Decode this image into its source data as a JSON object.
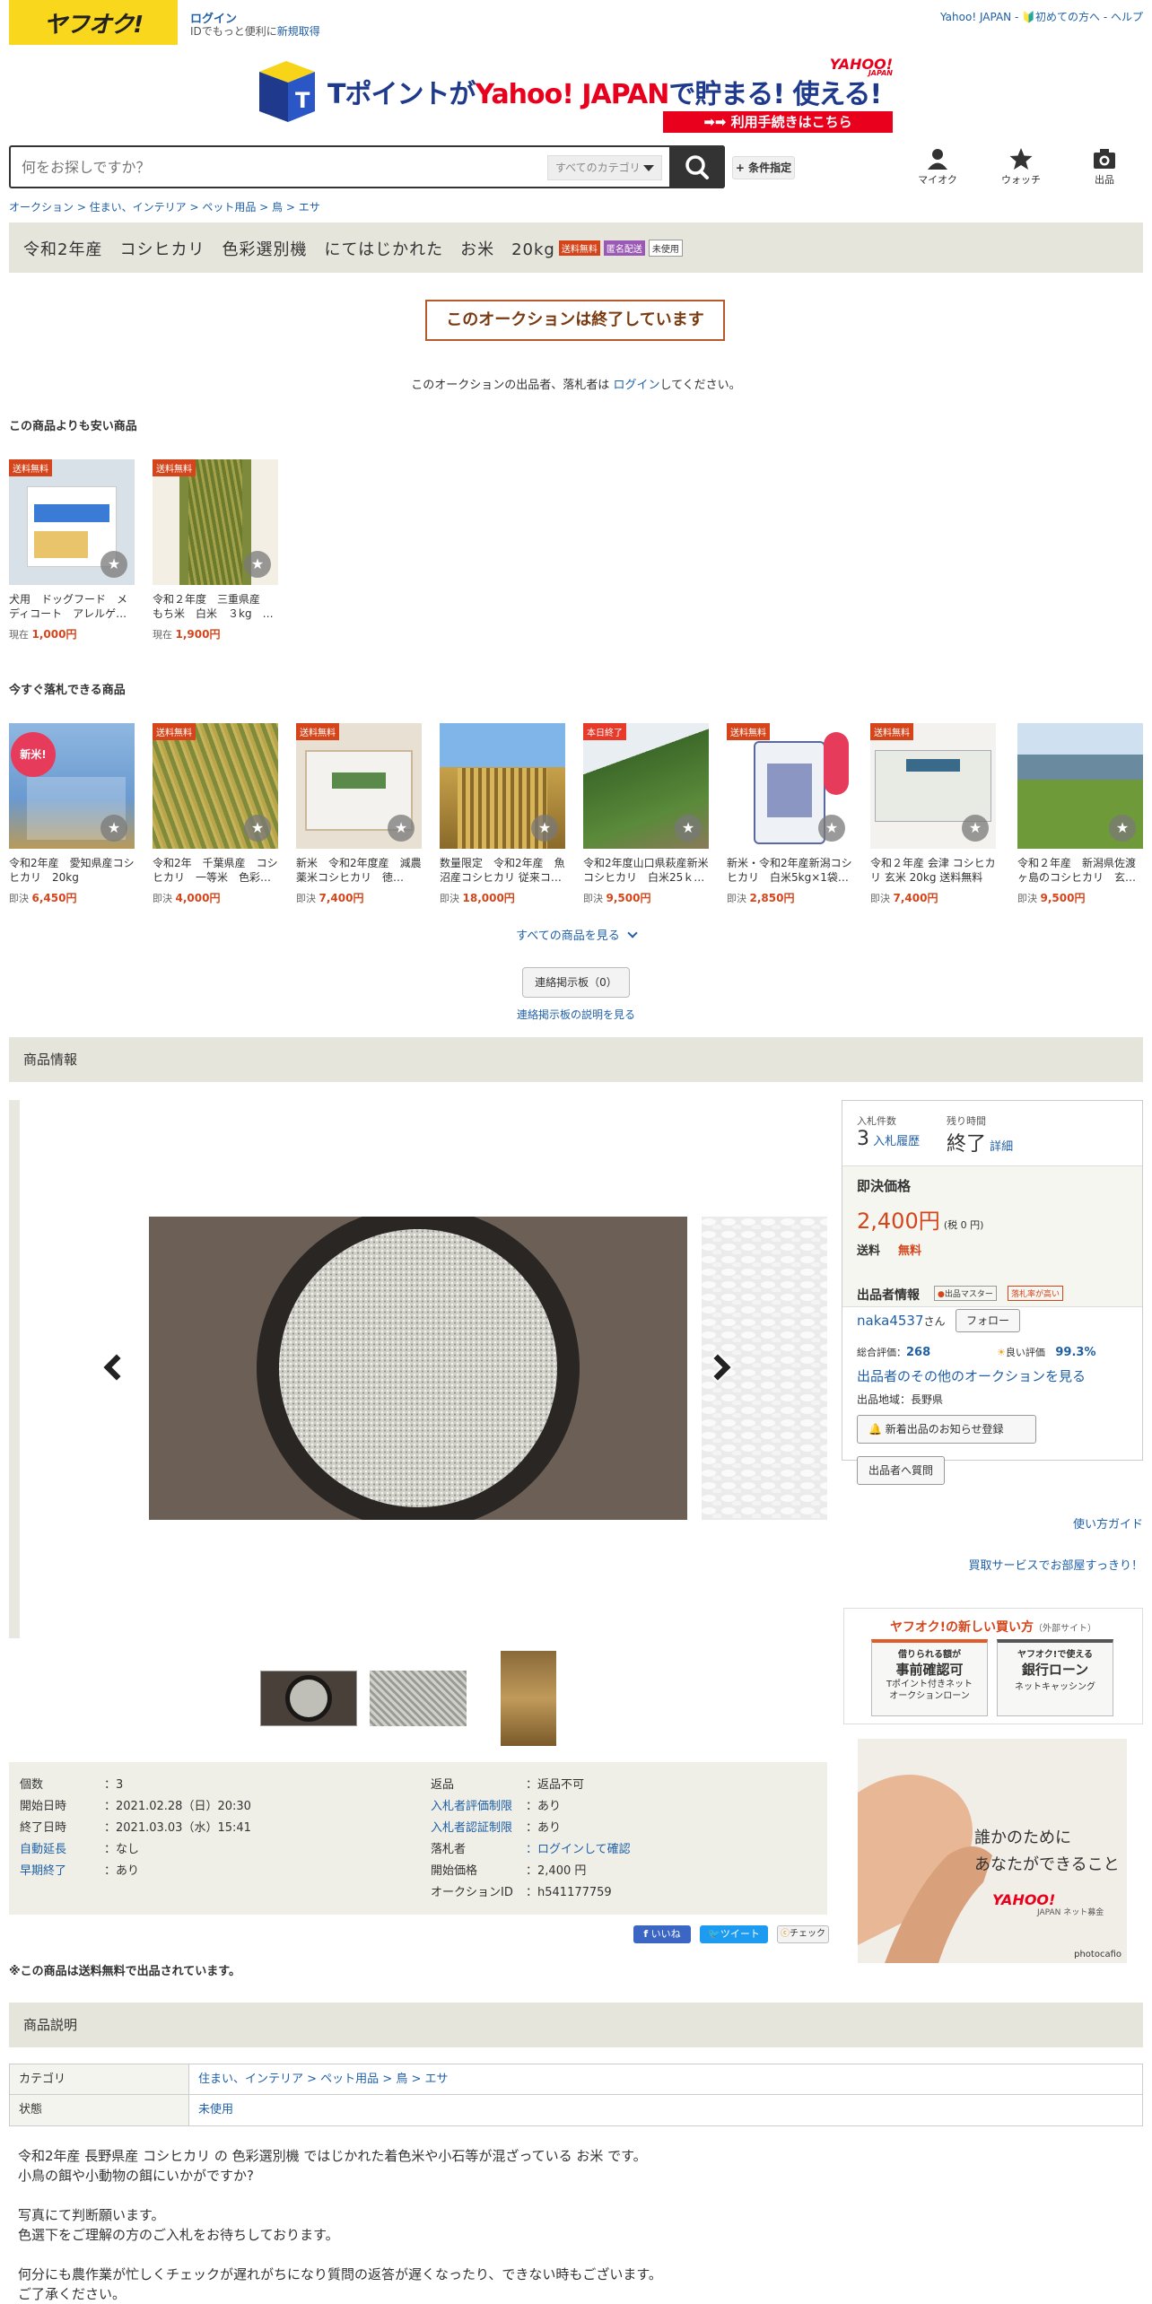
{
  "header": {
    "logo_text": "ヤフオク!",
    "login": "ログイン",
    "login_sub_prefix": "IDでもっと便利に",
    "login_sub_link": "新規取得",
    "top_links": "Yahoo! JAPAN - 🔰初めての方へ - ヘルプ"
  },
  "banner": {
    "main_left": "Tポイントが",
    "main_mid": "Yahoo! JAPAN",
    "main_right": "で貯まる! 使える!",
    "brand": "YAHOO!",
    "brand_sub": "JAPAN",
    "button": "➡➡ 利用手続きはこちら"
  },
  "search": {
    "placeholder": "何をお探しですか？",
    "category": "すべてのカテゴリ",
    "conditions": "+ 条件指定"
  },
  "header_icons": {
    "myauc": "マイオク",
    "watch": "ウォッチ",
    "sell": "出品"
  },
  "breadcrumb": "オークション > 住まい、インテリア > ペット用品 > 鳥 > エサ",
  "title": {
    "text": "令和2年産　コシヒカリ　色彩選別機　にてはじかれた　お米　20kg",
    "badges": [
      "送料無料",
      "匿名配送",
      "未使用"
    ],
    "badge_colors": [
      "#d5451b",
      "#9b59b6",
      "#ffffff"
    ]
  },
  "ended": {
    "banner": "このオークションは終了しています",
    "msg_prefix": "このオークションの出品者、落札者は ",
    "msg_link": "ログイン",
    "msg_suffix": "してください。"
  },
  "cheaper": {
    "heading": "この商品よりも安い商品",
    "items": [
      {
        "tag": "送料無料",
        "name": "犬用　ドッグフード　メディコート　アレルゲ…",
        "price_label": "現在",
        "price": "1,000円"
      },
      {
        "tag": "送料無料",
        "name": "令和２年度　三重県産　もち米　白米　３kg　…",
        "price_label": "現在",
        "price": "1,900円"
      }
    ]
  },
  "buynow": {
    "heading": "今すぐ落札できる商品",
    "items": [
      {
        "tag": "",
        "name": "令和2年産　愛知県産コシヒカリ　20kg",
        "price_label": "即決",
        "price": "6,450円"
      },
      {
        "tag": "送料無料",
        "name": "令和2年　千葉県産　コシヒカリ　一等米　色彩…",
        "price_label": "即決",
        "price": "4,000円"
      },
      {
        "tag": "送料無料",
        "name": "新米　令和2年度産　減農薬米コシヒカリ　徳…",
        "price_label": "即決",
        "price": "7,400円"
      },
      {
        "tag": "",
        "name": "数量限定　令和2年産　魚沼産コシヒカリ 従来コ…",
        "price_label": "即決",
        "price": "18,000円"
      },
      {
        "tag": "本日終了",
        "name": "令和2年度山口県萩産新米コシヒカリ　白米25ｋ…",
        "price_label": "即決",
        "price": "9,500円"
      },
      {
        "tag": "送料無料",
        "name": "新米・令和2年産新潟コシヒカリ　白米5kg×1袋…",
        "price_label": "即決",
        "price": "2,850円"
      },
      {
        "tag": "送料無料",
        "name": "令和２年産 会津 コシヒカリ 玄米 20kg 送料無料",
        "price_label": "即決",
        "price": "7,400円"
      },
      {
        "tag": "",
        "name": "令和２年産　新潟県佐渡ヶ島のコシヒカリ　玄…",
        "price_label": "即決",
        "price": "9,500円"
      }
    ],
    "see_all": "すべての商品を見る"
  },
  "board": {
    "button": "連絡掲示板（0）",
    "link": "連絡掲示板の説明を見る"
  },
  "product_info": {
    "heading": "商品情報"
  },
  "panel": {
    "bids_label": "入札件数",
    "bids_value": "3",
    "bids_link": "入札履歴",
    "time_label": "残り時間",
    "time_value": "終了",
    "time_link": "詳細",
    "buynow_label": "即決価格",
    "buynow_price": "2,400円",
    "buynow_tax": "(税 0 円)",
    "ship_label": "送料",
    "ship_value": "無料",
    "seller_heading": "出品者情報",
    "seller_badge1": "出品マスター",
    "seller_badge2": "落札率が高い",
    "seller_name": "naka4537",
    "seller_suffix": "さん",
    "follow": "フォロー",
    "rating_label": "総合評価：",
    "rating_value": "268",
    "good_label": "良い評価",
    "good_value": "99.3%",
    "other_link": "出品者のその他のオークションを見る",
    "region": "出品地域：長野県",
    "notify": "新着出品のお知らせ登録",
    "question": "出品者へ質問"
  },
  "side_links": {
    "guide": "使い方ガイド",
    "clean": "買取サービスでお部屋すっきり！"
  },
  "newbuy": {
    "title": "ヤフオク!の新しい買い方",
    "title_sub": "（外部サイト）",
    "card1_top": "借りられる額が",
    "card1_main": "事前確認可",
    "card1_sub": "Tポイント付きネット\nオークションローン",
    "card2_top": "ヤフオク!で使える",
    "card2_main": "銀行ローン",
    "card2_sub": "ネットキャッシング"
  },
  "ad": {
    "line1": "誰かのために",
    "line2": "あなたができること",
    "brand": "YAHOO!",
    "brand_sub": "JAPAN ネット募金",
    "credit": "photocafio"
  },
  "details": {
    "left": [
      {
        "k": "個数",
        "v": "3",
        "link": false
      },
      {
        "k": "開始日時",
        "v": "2021.02.28（日）20:30",
        "link": false
      },
      {
        "k": "終了日時",
        "v": "2021.03.03（水）15:41",
        "link": false
      },
      {
        "k": "自動延長",
        "v": "なし",
        "link": true
      },
      {
        "k": "早期終了",
        "v": "あり",
        "link": true
      }
    ],
    "right": [
      {
        "k": "返品",
        "v": "返品不可",
        "link": false
      },
      {
        "k": "入札者評価制限",
        "v": "あり",
        "link": true
      },
      {
        "k": "入札者認証制限",
        "v": "あり",
        "link": true
      },
      {
        "k": "落札者",
        "v": "ログインして確認",
        "link": false
      },
      {
        "k": "開始価格",
        "v": "2,400 円",
        "link": false
      },
      {
        "k": "オークションID",
        "v": "h541177759",
        "link": false
      }
    ]
  },
  "social": {
    "like": "いいね",
    "tweet": "ツイート",
    "check": "チェック"
  },
  "free_ship_note": "※この商品は送料無料で出品されています。",
  "description": {
    "heading": "商品説明",
    "category_label": "カテゴリ",
    "category_value": "住まい、インテリア > ペット用品 > 鳥 > エサ",
    "condition_label": "状態",
    "condition_value": "未使用",
    "lines": [
      "令和2年産 長野県産 コシヒカリ の 色彩選別機 ではじかれた着色米や小石等が混ざっている お米 です。",
      "小鳥の餌や小動物の餌にいかがですか?",
      "",
      "写真にて判断願います。",
      "色選下をご理解の方のご入札をお待ちしております。",
      "",
      "何分にも農作業が忙しくチェックが遅れがちになり質問の返答が遅くなったり、できない時もございます。",
      "ご了承ください。"
    ]
  }
}
